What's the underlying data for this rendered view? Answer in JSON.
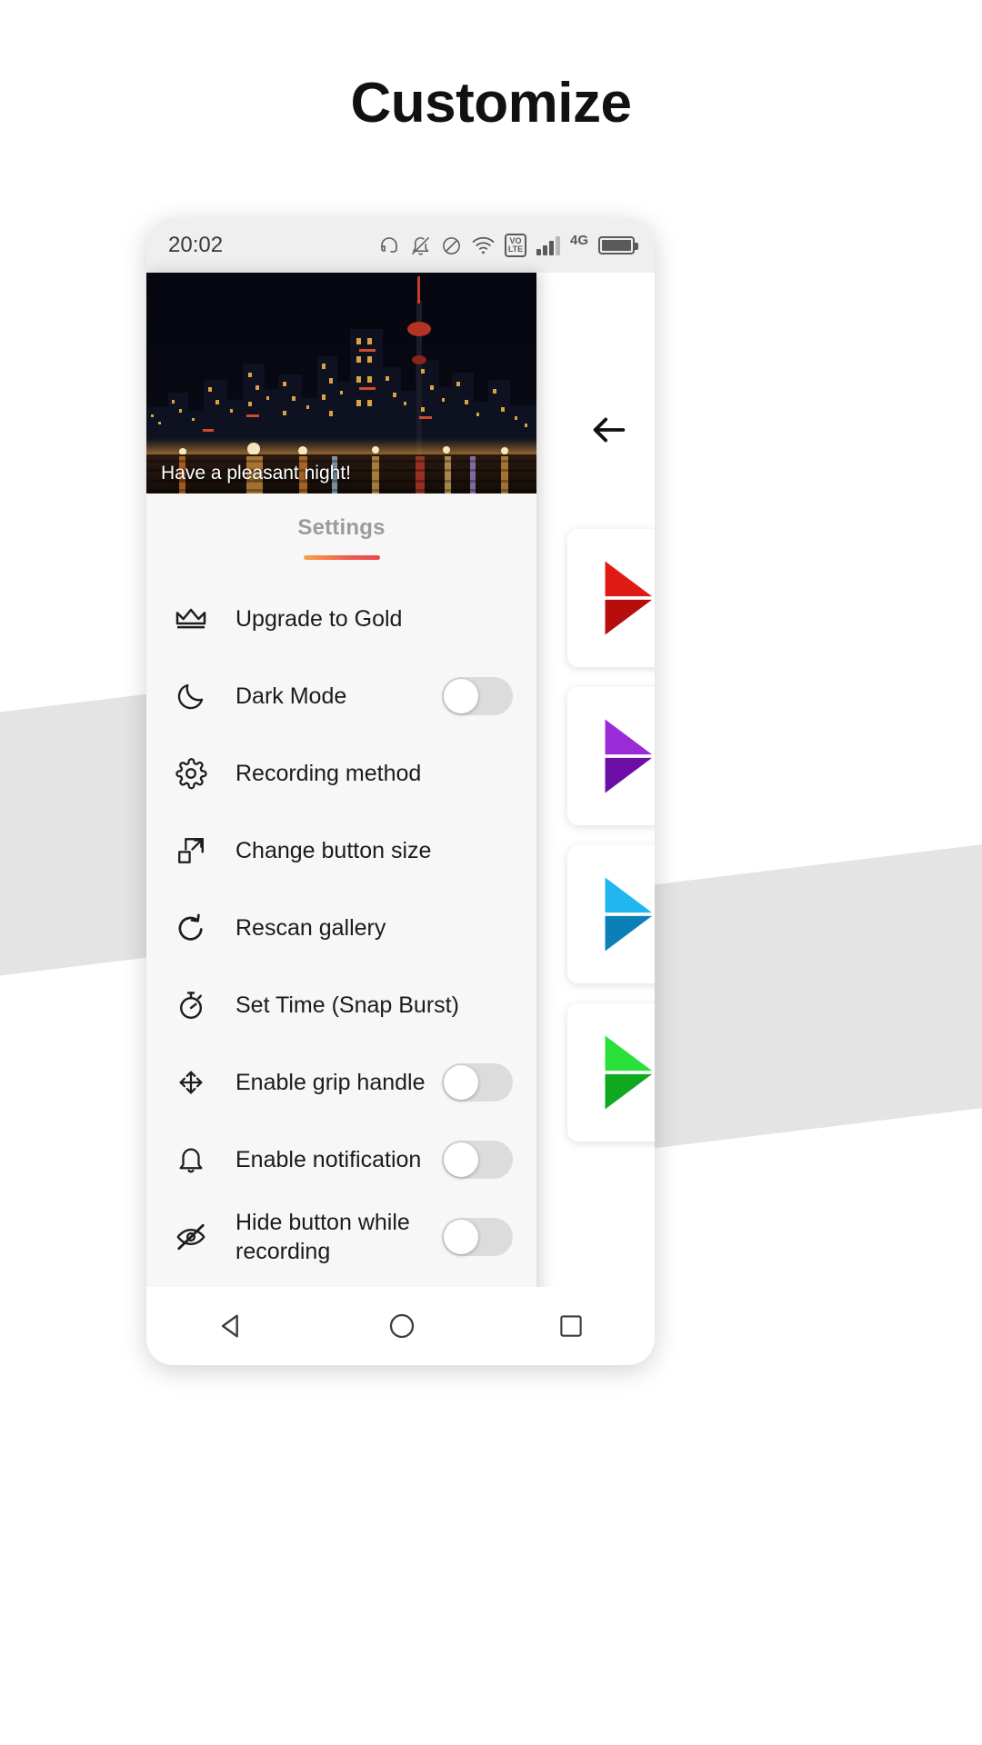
{
  "page": {
    "title": "Customize"
  },
  "phone": {
    "statusbar": {
      "time": "20:02",
      "icons": [
        {
          "name": "headset-icon"
        },
        {
          "name": "notifications-off-icon"
        },
        {
          "name": "do-not-disturb-icon"
        },
        {
          "name": "wifi-icon"
        },
        {
          "name": "volte-icon",
          "line1": "VO",
          "line2": "LTE"
        },
        {
          "name": "cellular-signal-icon"
        },
        {
          "name": "network-type-label",
          "label": "4G"
        },
        {
          "name": "battery-icon"
        }
      ]
    },
    "screen": {
      "back_arrow": "back-arrow-icon",
      "theme_cards": [
        {
          "name": "theme-card-red",
          "color": "#e01b16"
        },
        {
          "name": "theme-card-purple",
          "color": "#8a19c9"
        },
        {
          "name": "theme-card-blue",
          "color": "#0d8fd1"
        },
        {
          "name": "theme-card-green",
          "color": "#15c62a"
        }
      ]
    },
    "drawer": {
      "hero_caption": "Have a pleasant night!",
      "tab_label": "Settings",
      "accent_gradient_start": "#f7a443",
      "accent_gradient_end": "#e8474c",
      "menu": [
        {
          "icon": "crown-icon",
          "label": "Upgrade to Gold",
          "toggle": null
        },
        {
          "icon": "moon-icon",
          "label": "Dark Mode",
          "toggle": "off"
        },
        {
          "icon": "gear-icon",
          "label": "Recording method",
          "toggle": null
        },
        {
          "icon": "resize-icon",
          "label": "Change button size",
          "toggle": null
        },
        {
          "icon": "refresh-ccw-icon",
          "label": "Rescan gallery",
          "toggle": null
        },
        {
          "icon": "stopwatch-icon",
          "label": "Set Time (Snap Burst)",
          "toggle": null
        },
        {
          "icon": "move-icon",
          "label": "Enable grip handle",
          "toggle": "off"
        },
        {
          "icon": "bell-icon",
          "label": "Enable notification",
          "toggle": "off"
        },
        {
          "icon": "eye-off-icon",
          "label": "Hide button while recording",
          "toggle": "off"
        }
      ]
    },
    "navbar": [
      {
        "name": "nav-back-button"
      },
      {
        "name": "nav-home-button"
      },
      {
        "name": "nav-recents-button"
      }
    ]
  }
}
